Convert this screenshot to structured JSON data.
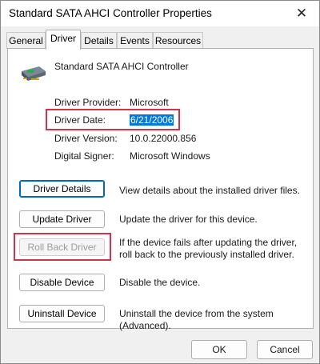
{
  "window": {
    "title": "Standard SATA AHCI Controller Properties",
    "close_glyph": "✕"
  },
  "tabs": [
    {
      "label": "General",
      "active": false
    },
    {
      "label": "Driver",
      "active": true
    },
    {
      "label": "Details",
      "active": false
    },
    {
      "label": "Events",
      "active": false
    },
    {
      "label": "Resources",
      "active": false
    }
  ],
  "device": {
    "name": "Standard SATA AHCI Controller",
    "icon": "storage-controller-icon"
  },
  "info": {
    "provider_label": "Driver Provider:",
    "provider_value": "Microsoft",
    "date_label": "Driver Date:",
    "date_value": "6/21/2006",
    "version_label": "Driver Version:",
    "version_value": "10.0.22000.856",
    "signer_label": "Digital Signer:",
    "signer_value": "Microsoft Windows"
  },
  "actions": [
    {
      "label": "Driver Details",
      "desc": "View details about the installed driver files.",
      "enabled": true
    },
    {
      "label": "Update Driver",
      "desc": "Update the driver for this device.",
      "enabled": true
    },
    {
      "label": "Roll Back Driver",
      "desc": "If the device fails after updating the driver, roll back to the previously installed driver.",
      "enabled": false
    },
    {
      "label": "Disable Device",
      "desc": "Disable the device.",
      "enabled": true
    },
    {
      "label": "Uninstall Device",
      "desc": "Uninstall the device from the system (Advanced).",
      "enabled": true
    }
  ],
  "footer": {
    "ok_label": "OK",
    "cancel_label": "Cancel"
  },
  "colors": {
    "highlight": "#d0334a",
    "selection": "#0078d7",
    "accent": "#0067c0"
  }
}
